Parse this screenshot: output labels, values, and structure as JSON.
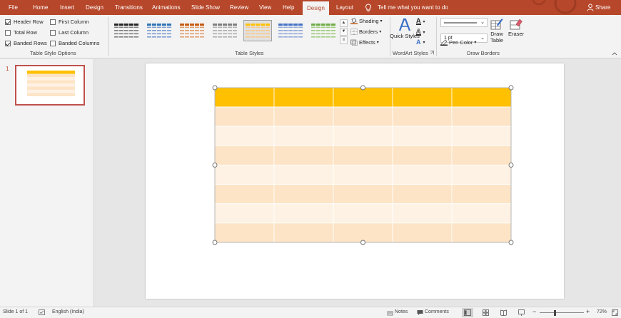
{
  "ribbon_tabs": [
    {
      "label": "File"
    },
    {
      "label": "Home"
    },
    {
      "label": "Insert"
    },
    {
      "label": "Design"
    },
    {
      "label": "Transitions"
    },
    {
      "label": "Animations"
    },
    {
      "label": "Slide Show"
    },
    {
      "label": "Review"
    },
    {
      "label": "View"
    },
    {
      "label": "Help"
    },
    {
      "label": "Design"
    },
    {
      "label": "Layout"
    }
  ],
  "active_tab_index": 10,
  "tell_me": "Tell me what you want to do",
  "share": "Share",
  "table_style_options": {
    "group_label": "Table Style Options",
    "options": [
      {
        "label": "Header Row",
        "checked": true
      },
      {
        "label": "First Column",
        "checked": false
      },
      {
        "label": "Total Row",
        "checked": false
      },
      {
        "label": "Last Column",
        "checked": false
      },
      {
        "label": "Banded Rows",
        "checked": true
      },
      {
        "label": "Banded Columns",
        "checked": false
      }
    ]
  },
  "table_styles": {
    "group_label": "Table Styles",
    "gallery": [
      {
        "header": "#262626",
        "band": "#7f7f7f"
      },
      {
        "header": "#2e75b6",
        "band": "#7f9fcf"
      },
      {
        "header": "#c55a11",
        "band": "#e0a070"
      },
      {
        "header": "#7f7f7f",
        "band": "#b0b0b0"
      },
      {
        "header": "#ffc000",
        "band": "#f7c98a"
      },
      {
        "header": "#4472c4",
        "band": "#8fa8d8"
      },
      {
        "header": "#70ad47",
        "band": "#9fcb7f"
      }
    ],
    "selected_index": 4,
    "shading": "Shading",
    "borders": "Borders",
    "effects": "Effects"
  },
  "wordart": {
    "group_label": "WordArt Styles",
    "quick_styles": "Quick Styles"
  },
  "draw_borders": {
    "group_label": "Draw Borders",
    "pen_weight": "1 pt",
    "pen_color": "Pen Color",
    "draw_table": "Draw Table",
    "eraser": "Eraser"
  },
  "thumbnails": [
    {
      "number": "1"
    }
  ],
  "table": {
    "header_color": "#ffc000",
    "band_dark": "#fde4c6",
    "band_light": "#fef2e4",
    "rows": 8,
    "cols": 5
  },
  "status_bar": {
    "slide_info": "Slide 1 of 1",
    "language": "English (India)",
    "notes": "Notes",
    "comments": "Comments",
    "zoom": "72%"
  }
}
